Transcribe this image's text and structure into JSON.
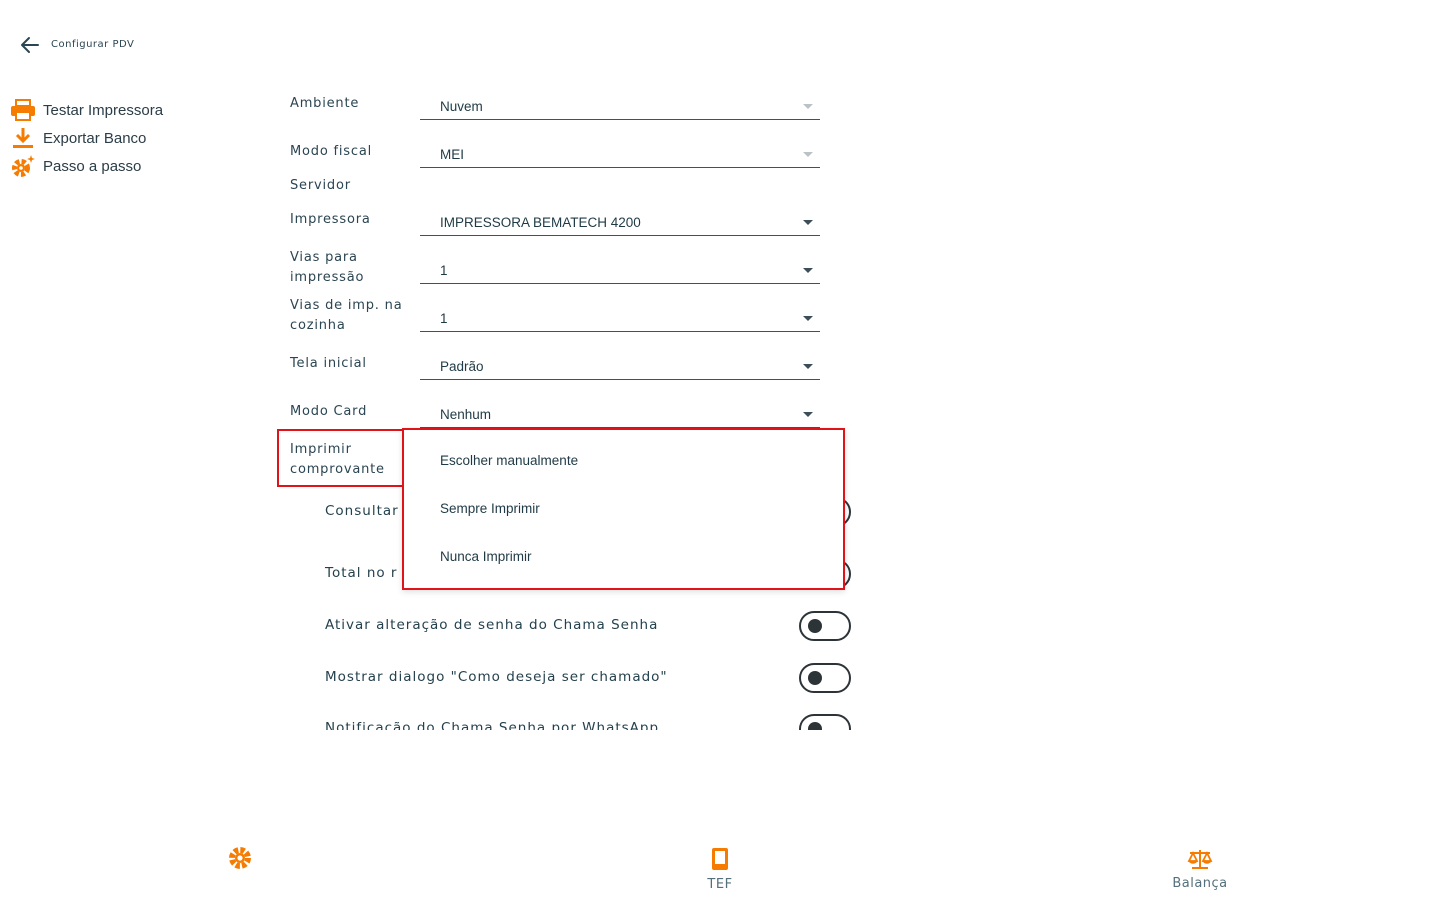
{
  "header": {
    "title": "Configurar PDV"
  },
  "side_menu": [
    {
      "label": "Testar Impressora",
      "icon": "printer-icon"
    },
    {
      "label": "Exportar Banco",
      "icon": "download-icon"
    },
    {
      "label": "Passo a passo",
      "icon": "gear-sparkle-icon"
    }
  ],
  "form": {
    "ambiente": {
      "label": "Ambiente",
      "value": "Nuvem"
    },
    "modo_fiscal": {
      "label": "Modo fiscal",
      "value": "MEI"
    },
    "servidor": {
      "label": "Servidor"
    },
    "impressora": {
      "label": "Impressora",
      "value": "IMPRESSORA BEMATECH 4200"
    },
    "vias_impressao": {
      "label": "Vias para impressão",
      "value": "1"
    },
    "vias_cozinha": {
      "label": "Vias de imp. na cozinha",
      "value": "1"
    },
    "tela_inicial": {
      "label": "Tela inicial",
      "value": "Padrão"
    },
    "modo_card": {
      "label": "Modo Card",
      "value": "Nenhum"
    },
    "imprimir_comprovante": {
      "label": "Imprimir comprovante"
    }
  },
  "dropdown": {
    "options": [
      "Escolher manualmente",
      "Sempre Imprimir",
      "Nunca Imprimir"
    ]
  },
  "toggles": [
    {
      "label": "Consultar",
      "on": false
    },
    {
      "label": "Total no r",
      "on": false
    },
    {
      "label": "Ativar alteração de senha do Chama Senha",
      "on": false
    },
    {
      "label": "Mostrar dialogo \"Como deseja ser chamado\"",
      "on": false
    },
    {
      "label": "Notificação do Chama Senha por WhatsApp",
      "on": false
    }
  ],
  "bottom_nav": {
    "settings": {
      "icon": "gear-icon"
    },
    "tef": {
      "label": "TEF",
      "icon": "phone-icon"
    },
    "balanca": {
      "label": "Balança",
      "icon": "scale-icon"
    }
  },
  "colors": {
    "accent": "#f57c00",
    "text": "#24414d",
    "highlight": "#e0121a"
  }
}
